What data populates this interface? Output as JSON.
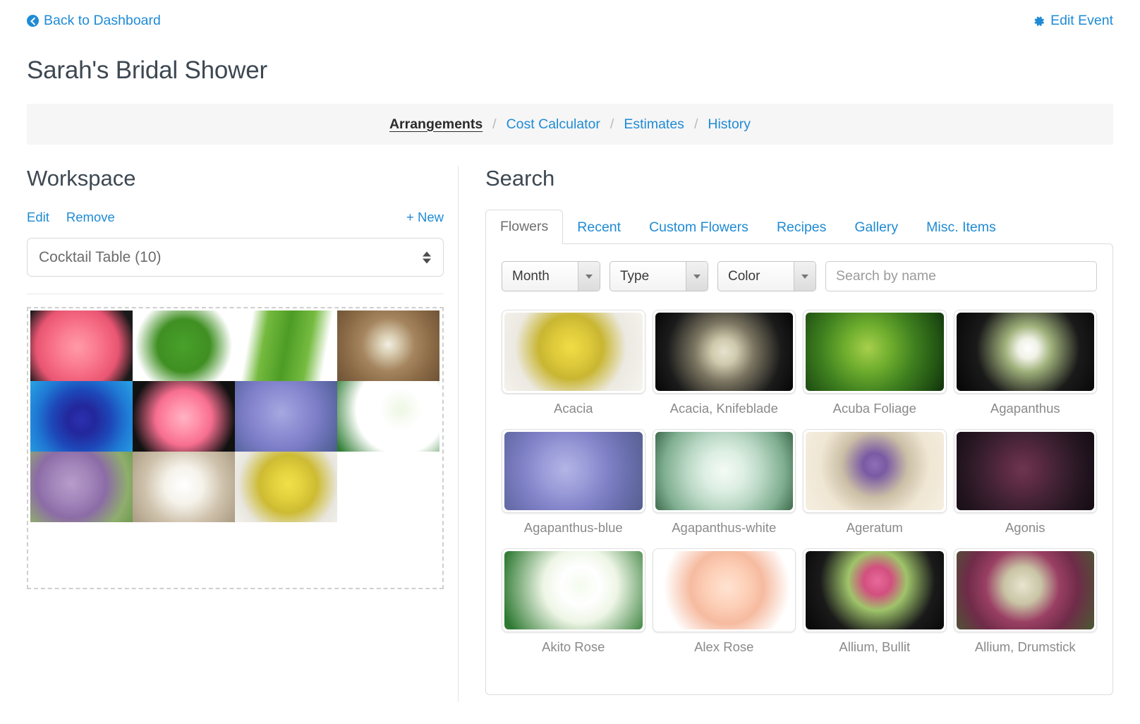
{
  "header": {
    "back_label": "Back to Dashboard",
    "back_icon": "arrow-circle-left-icon",
    "edit_label": "Edit Event",
    "edit_icon": "gear-icon",
    "title": "Sarah's Bridal Shower",
    "link_color": "#1f8bd4"
  },
  "breadcrumb": {
    "separator": "/",
    "items": [
      {
        "label": "Arrangements",
        "active": true
      },
      {
        "label": "Cost Calculator",
        "active": false
      },
      {
        "label": "Estimates",
        "active": false
      },
      {
        "label": "History",
        "active": false
      }
    ]
  },
  "workspace": {
    "heading": "Workspace",
    "edit_label": "Edit",
    "remove_label": "Remove",
    "new_label": "+ New",
    "selected_arrangement": "Cocktail Table (10)",
    "items": [
      {
        "name": "pink-peony",
        "style": "radial-gradient(circle at 46% 52%, #ff9aa6 0%, #fb7f93 26%, #f4677f 46%, #e85572 62%, #1a1a1a 88%)"
      },
      {
        "name": "maidenhair-fern",
        "style": "radial-gradient(circle at 50% 50%, #49a12a 0%, #3f8f22 42%, #ffffff 78%)"
      },
      {
        "name": "sword-fern",
        "style": "linear-gradient(100deg, #ffffff 0%, #ffffff 16%, #74ba3e 30%, #4d9c25 50%, #75bb40 70%, #ffffff 86%, #ffffff 100%)"
      },
      {
        "name": "daisy-heart-wood",
        "style": "radial-gradient(circle at 50% 48%, #f2efe2 0%, #d8cbb0 16%, #a5855f 42%, #8a6a46 70%, #6d5236 100%)"
      },
      {
        "name": "blue-rose",
        "style": "radial-gradient(circle at 50% 55%, #2b2fae 0%, #23279c 22%, #1d47b8 46%, #1f79d4 70%, #29a3e4 100%)"
      },
      {
        "name": "pink-peony-dark",
        "style": "radial-gradient(circle at 50% 52%, #ffb3c4 0%, #ff8fa9 24%, #f76e90 44%, #111111 82%)"
      },
      {
        "name": "agapanthus-purple",
        "style": "radial-gradient(circle at 45% 45%, #a6a8e0 0%, #8e8fd4 30%, #7b7cc6 55%, #5f6aa8 80%, #4c5b8c 100%)"
      },
      {
        "name": "white-roses-leaves",
        "style": "radial-gradient(circle at 62% 40%, #eef7e4 0%, #ffffff 28%, #ffffff 58%, #2e7d32 96%)"
      },
      {
        "name": "allium-purple",
        "style": "radial-gradient(circle at 40% 45%, #b89ccb 0%, #a285ba 26%, #8c6ca6 48%, #8fae6d 78%, #6f9a4f 100%)"
      },
      {
        "name": "white-blossom",
        "style": "radial-gradient(circle at 50% 48%, #ffffff 0%, #f5f2ea 30%, #cfc2ac 62%, #a99a82 100%)"
      },
      {
        "name": "yellow-acacia-bag",
        "style": "radial-gradient(circle at 52% 46%, #f2e04a 0%, #e2cf3c 24%, #cdbb33 44%, #e8e6df 76%, #f3f1ec 100%)"
      }
    ]
  },
  "search": {
    "heading": "Search",
    "tabs": [
      {
        "label": "Flowers",
        "active": true
      },
      {
        "label": "Recent",
        "active": false
      },
      {
        "label": "Custom Flowers",
        "active": false
      },
      {
        "label": "Recipes",
        "active": false
      },
      {
        "label": "Gallery",
        "active": false
      },
      {
        "label": "Misc. Items",
        "active": false
      }
    ],
    "filters": [
      {
        "label": "Month",
        "icon": "chevron-down-icon"
      },
      {
        "label": "Type",
        "icon": "chevron-down-icon"
      },
      {
        "label": "Color",
        "icon": "chevron-down-icon"
      }
    ],
    "search_placeholder": "Search by name",
    "search_value": "",
    "results": [
      {
        "label": "Acacia",
        "style": "radial-gradient(circle at 48% 44%, #f0dd45 0%, #ddc93a 22%, #c9b632 38%, #ece9e1 66%, #f6f4ef 100%)"
      },
      {
        "label": "Acacia, Knifeblade",
        "style": "radial-gradient(circle at 50% 50%, #e6e2cd 0%, #cfc9ad 16%, #7a7460 38%, #1b1b1b 72%, #060606 100%)"
      },
      {
        "label": "Acuba Foliage",
        "style": "radial-gradient(circle at 45% 45%, #a8cf4c 0%, #6fae2e 26%, #3f7f1f 54%, #1f4f12 84%, #122f0b 100%)"
      },
      {
        "label": "Agapanthus",
        "style": "radial-gradient(circle at 52% 46%, #ffffff 0%, #f0f2e6 12%, #9fb07a 28%, #1a1a1a 62%, #050505 100%)"
      },
      {
        "label": "Agapanthus-blue",
        "style": "radial-gradient(circle at 44% 48%, #b3b5e6 0%, #9a9bd8 26%, #8182c8 48%, #6a6fae 72%, #555f8f 100%)"
      },
      {
        "label": "Agapanthus-white",
        "style": "radial-gradient(circle at 50% 50%, #f4fbf6 0%, #dceee2 26%, #b9d7c4 48%, #7fae90 76%, #3f6b4c 100%)"
      },
      {
        "label": "Ageratum",
        "style": "radial-gradient(circle at 50% 42%, #8e6fb5 0%, #7a5aa3 14%, #cbbfa6 40%, #efe6d3 66%, #f6efe1 100%)"
      },
      {
        "label": "Agonis",
        "style": "radial-gradient(circle at 48% 48%, #6e3550 0%, #5a2a42 22%, #3c2031 48%, #241520 74%, #140c13 100%)"
      },
      {
        "label": "Akito Rose",
        "style": "radial-gradient(circle at 55% 44%, #f4fbee 0%, #ffffff 22%, #eef6e6 42%, #2f7a33 92%)"
      },
      {
        "label": "Alex Rose",
        "style": "radial-gradient(circle at 52% 46%, #ffe3d2 0%, #fdd0b8 24%, #f6bba0 44%, #ffffff 76%, #ffffff 100%)"
      },
      {
        "label": "Allium, Bullit",
        "style": "radial-gradient(circle at 52% 38%, #e8699a 0%, #d2507f 16%, #9fc46a 34%, #1a1a1a 66%, #050505 100%)"
      },
      {
        "label": "Allium, Drumstick",
        "style": "radial-gradient(circle at 48% 44%, #e8e4cf 0%, #c9c4a5 22%, #9a3f63 44%, #6f2c48 66%, #4a5a33 100%)"
      }
    ]
  }
}
